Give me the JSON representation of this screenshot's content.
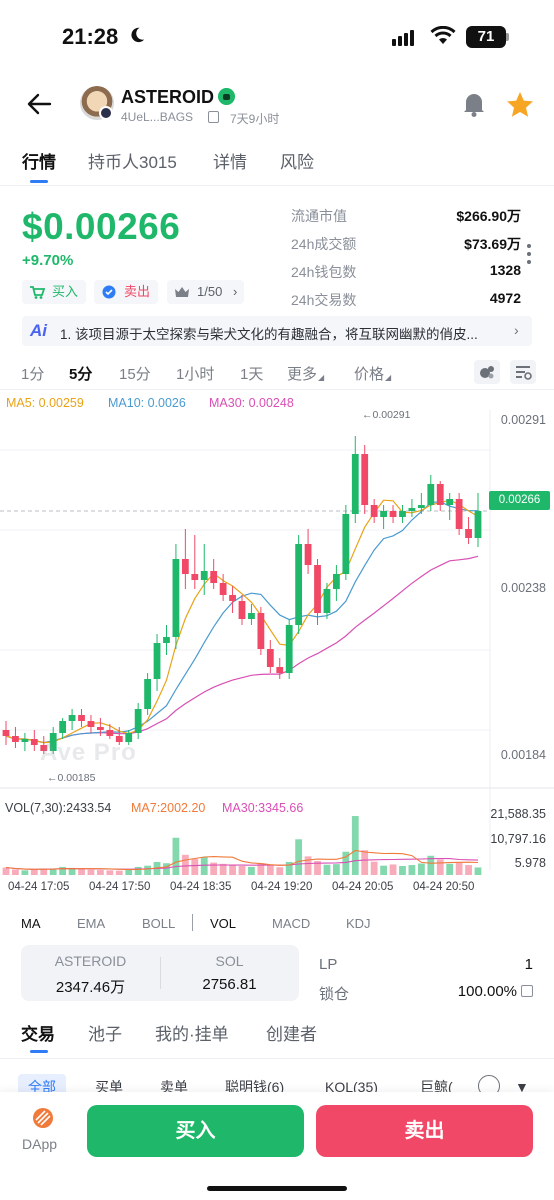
{
  "status_bar": {
    "time": "21:28",
    "battery": "71"
  },
  "header": {
    "token_name": "ASTEROID",
    "address": "4UeL...BAGS",
    "age": "7天9小时",
    "icons": [
      "back-arrow-icon",
      "copy-icon",
      "bell-icon",
      "star-icon"
    ]
  },
  "tabs": [
    "行情",
    "持币人3015",
    "详情",
    "风险"
  ],
  "price": {
    "value": "$0.00266",
    "change": "+9.70%",
    "buy_label": "买入",
    "sell_label": "卖出",
    "rank_label": "1/50"
  },
  "stats": [
    {
      "label": "流通市值",
      "value": "$266.90万"
    },
    {
      "label": "24h成交额",
      "value": "$73.69万"
    },
    {
      "label": "24h钱包数",
      "value": "1328"
    },
    {
      "label": "24h交易数",
      "value": "4972"
    }
  ],
  "ai_banner": {
    "icon_text": "Ai",
    "text": "1. 该项目源于太空探索与柴犬文化的有趣融合，将互联网幽默的俏皮..."
  },
  "timeframes": [
    "1分",
    "5分",
    "15分",
    "1小时",
    "1天",
    "更多",
    "价格"
  ],
  "ma_legend": {
    "ma5": "MA5: 0.00259",
    "ma10": "MA10: 0.0026",
    "ma30": "MA30: 0.00248"
  },
  "chart_data": {
    "type": "candlestick",
    "y_labels": [
      "0.00291",
      "0.00238",
      "0.00184"
    ],
    "current_price": "0.00266",
    "high_marker": "←0.00291",
    "low_marker": "←0.00185",
    "watermark": "Ave Pro",
    "ylim": [
      0.00174,
      0.00298
    ],
    "time_labels": [
      "04-24 17:05",
      "04-24 17:50",
      "04-24 18:35",
      "04-24 19:20",
      "04-24 20:05",
      "04-24 20:50"
    ],
    "candles": [
      {
        "o": 0.00193,
        "h": 0.00196,
        "l": 0.00188,
        "c": 0.00191
      },
      {
        "o": 0.00191,
        "h": 0.00194,
        "l": 0.00187,
        "c": 0.00189
      },
      {
        "o": 0.00189,
        "h": 0.00192,
        "l": 0.00186,
        "c": 0.0019
      },
      {
        "o": 0.0019,
        "h": 0.00193,
        "l": 0.00186,
        "c": 0.00188
      },
      {
        "o": 0.00188,
        "h": 0.00191,
        "l": 0.00185,
        "c": 0.00186
      },
      {
        "o": 0.00186,
        "h": 0.00194,
        "l": 0.00185,
        "c": 0.00192
      },
      {
        "o": 0.00192,
        "h": 0.00197,
        "l": 0.0019,
        "c": 0.00196
      },
      {
        "o": 0.00196,
        "h": 0.002,
        "l": 0.00193,
        "c": 0.00198
      },
      {
        "o": 0.00198,
        "h": 0.002,
        "l": 0.00194,
        "c": 0.00196
      },
      {
        "o": 0.00196,
        "h": 0.00198,
        "l": 0.00192,
        "c": 0.00194
      },
      {
        "o": 0.00194,
        "h": 0.00197,
        "l": 0.00191,
        "c": 0.00193
      },
      {
        "o": 0.00193,
        "h": 0.00195,
        "l": 0.0019,
        "c": 0.00191
      },
      {
        "o": 0.00191,
        "h": 0.00194,
        "l": 0.00188,
        "c": 0.00189
      },
      {
        "o": 0.00189,
        "h": 0.00193,
        "l": 0.00188,
        "c": 0.00192
      },
      {
        "o": 0.00192,
        "h": 0.00202,
        "l": 0.0019,
        "c": 0.002
      },
      {
        "o": 0.002,
        "h": 0.00212,
        "l": 0.00198,
        "c": 0.0021
      },
      {
        "o": 0.0021,
        "h": 0.00225,
        "l": 0.00206,
        "c": 0.00222
      },
      {
        "o": 0.00222,
        "h": 0.00228,
        "l": 0.00218,
        "c": 0.00224
      },
      {
        "o": 0.00224,
        "h": 0.00255,
        "l": 0.0022,
        "c": 0.0025
      },
      {
        "o": 0.0025,
        "h": 0.0026,
        "l": 0.0024,
        "c": 0.00245
      },
      {
        "o": 0.00245,
        "h": 0.00258,
        "l": 0.0024,
        "c": 0.00243
      },
      {
        "o": 0.00243,
        "h": 0.00255,
        "l": 0.00238,
        "c": 0.00246
      },
      {
        "o": 0.00246,
        "h": 0.0025,
        "l": 0.0024,
        "c": 0.00242
      },
      {
        "o": 0.00242,
        "h": 0.00245,
        "l": 0.00236,
        "c": 0.00238
      },
      {
        "o": 0.00238,
        "h": 0.00241,
        "l": 0.00232,
        "c": 0.00236
      },
      {
        "o": 0.00236,
        "h": 0.00238,
        "l": 0.00228,
        "c": 0.0023
      },
      {
        "o": 0.0023,
        "h": 0.00235,
        "l": 0.00228,
        "c": 0.00232
      },
      {
        "o": 0.00232,
        "h": 0.00234,
        "l": 0.00218,
        "c": 0.0022
      },
      {
        "o": 0.0022,
        "h": 0.00223,
        "l": 0.00212,
        "c": 0.00214
      },
      {
        "o": 0.00214,
        "h": 0.00217,
        "l": 0.0021,
        "c": 0.00212
      },
      {
        "o": 0.00212,
        "h": 0.0023,
        "l": 0.0021,
        "c": 0.00228
      },
      {
        "o": 0.00228,
        "h": 0.00258,
        "l": 0.00225,
        "c": 0.00255
      },
      {
        "o": 0.00255,
        "h": 0.0026,
        "l": 0.00245,
        "c": 0.00248
      },
      {
        "o": 0.00248,
        "h": 0.0025,
        "l": 0.00228,
        "c": 0.00232
      },
      {
        "o": 0.00232,
        "h": 0.00242,
        "l": 0.0023,
        "c": 0.0024
      },
      {
        "o": 0.0024,
        "h": 0.00248,
        "l": 0.00236,
        "c": 0.00245
      },
      {
        "o": 0.00245,
        "h": 0.00268,
        "l": 0.00243,
        "c": 0.00265
      },
      {
        "o": 0.00265,
        "h": 0.00291,
        "l": 0.00262,
        "c": 0.00285
      },
      {
        "o": 0.00285,
        "h": 0.00288,
        "l": 0.00265,
        "c": 0.00268
      },
      {
        "o": 0.00268,
        "h": 0.0027,
        "l": 0.00262,
        "c": 0.00264
      },
      {
        "o": 0.00264,
        "h": 0.00268,
        "l": 0.0026,
        "c": 0.00266
      },
      {
        "o": 0.00266,
        "h": 0.00268,
        "l": 0.00262,
        "c": 0.00264
      },
      {
        "o": 0.00264,
        "h": 0.00268,
        "l": 0.00262,
        "c": 0.00266
      },
      {
        "o": 0.00266,
        "h": 0.0027,
        "l": 0.00264,
        "c": 0.00267
      },
      {
        "o": 0.00267,
        "h": 0.00272,
        "l": 0.00265,
        "c": 0.00268
      },
      {
        "o": 0.00268,
        "h": 0.00278,
        "l": 0.00266,
        "c": 0.00275
      },
      {
        "o": 0.00275,
        "h": 0.00276,
        "l": 0.00266,
        "c": 0.00268
      },
      {
        "o": 0.00268,
        "h": 0.00272,
        "l": 0.00263,
        "c": 0.0027
      },
      {
        "o": 0.0027,
        "h": 0.00272,
        "l": 0.00258,
        "c": 0.0026
      },
      {
        "o": 0.0026,
        "h": 0.00264,
        "l": 0.00255,
        "c": 0.00257
      },
      {
        "o": 0.00257,
        "h": 0.00272,
        "l": 0.00254,
        "c": 0.00266
      }
    ],
    "volume": {
      "legend": {
        "vol": "VOL(7,30):2433.54",
        "ma7": "MA7:2002.20",
        "ma30": "MA30:3345.66"
      },
      "y_labels": [
        "21,588.35",
        "10,797.16",
        "5.978"
      ],
      "ymax": 21588.35,
      "values": [
        2400,
        1800,
        1500,
        1700,
        2000,
        2100,
        2600,
        2300,
        1900,
        1700,
        1600,
        1500,
        1400,
        1800,
        2600,
        3000,
        4200,
        3800,
        12000,
        6500,
        5200,
        5800,
        4000,
        3600,
        3100,
        2900,
        2600,
        3800,
        3300,
        2500,
        4200,
        11500,
        6000,
        4500,
        3300,
        3500,
        7500,
        19000,
        8000,
        4300,
        3000,
        3400,
        2900,
        3200,
        3700,
        6200,
        5000,
        3600,
        4000,
        3200,
        2433
      ]
    }
  },
  "indicator_tabs": [
    "MA",
    "EMA",
    "BOLL",
    "VOL",
    "MACD",
    "KDJ"
  ],
  "liquidity": {
    "token_label": "ASTEROID",
    "token_value": "2347.46万",
    "sol_label": "SOL",
    "sol_value": "2756.81",
    "lp_label": "LP",
    "lp_value": "1",
    "lock_label": "锁仓",
    "lock_value": "100.00%"
  },
  "bottom_tabs": [
    "交易",
    "池子",
    "我的·挂单",
    "创建者"
  ],
  "filters": [
    "全部",
    "买单",
    "卖单",
    "聪明钱(6)",
    "KOL(35)",
    "巨鲸("
  ],
  "bottom_bar": {
    "dapp_label": "DApp",
    "buy": "买入",
    "sell": "卖出"
  },
  "colors": {
    "up": "#1fb86a",
    "down": "#f04866",
    "accent": "#2f7cf6",
    "ma5": "#e8a317",
    "ma10": "#4a9bd1",
    "ma30": "#d94fb5"
  }
}
